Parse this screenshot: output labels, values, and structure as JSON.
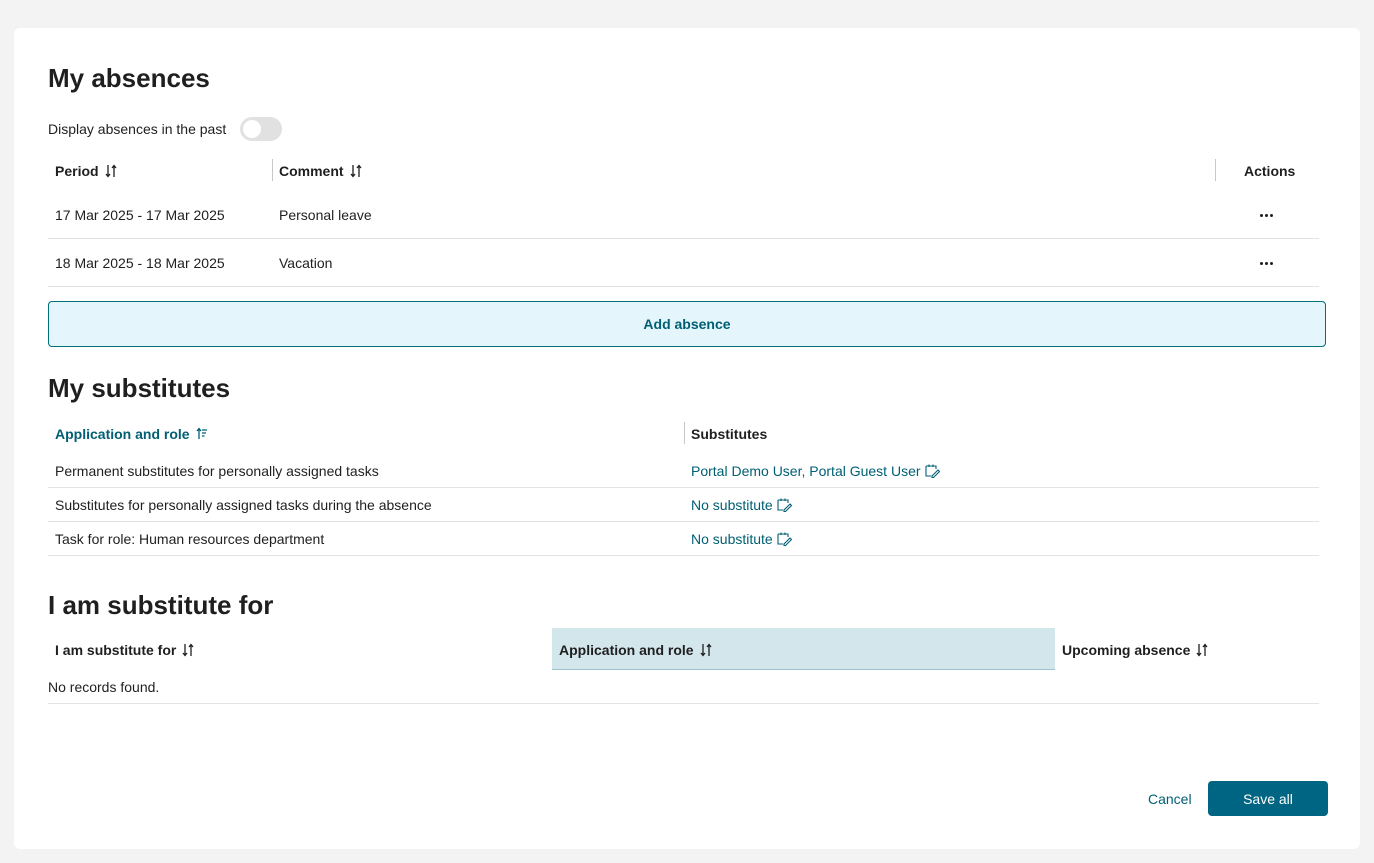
{
  "absences": {
    "title": "My absences",
    "toggle_label": "Display absences in the past",
    "toggle_on": false,
    "columns": {
      "period": "Period",
      "comment": "Comment",
      "actions": "Actions"
    },
    "rows": [
      {
        "period": "17 Mar 2025 - 17 Mar 2025",
        "comment": "Personal leave"
      },
      {
        "period": "18 Mar 2025 - 18 Mar 2025",
        "comment": "Vacation"
      }
    ],
    "add_label": "Add absence"
  },
  "substitutes": {
    "title": "My substitutes",
    "columns": {
      "app_role": "Application and role",
      "substitutes": "Substitutes"
    },
    "rows": [
      {
        "app_role": "Permanent substitutes for personally assigned tasks",
        "substitutes": "Portal Demo User, Portal Guest User"
      },
      {
        "app_role": "Substitutes for personally assigned tasks during the absence",
        "substitutes": "No substitute"
      },
      {
        "app_role": "Task for role: Human resources department",
        "substitutes": "No substitute"
      }
    ]
  },
  "substitute_for": {
    "title": "I am substitute for",
    "columns": {
      "person": "I am substitute for",
      "app_role": "Application and role",
      "upcoming": "Upcoming absence"
    },
    "empty_text": "No records found."
  },
  "footer": {
    "cancel_label": "Cancel",
    "save_label": "Save all"
  },
  "colors": {
    "accent": "#005f73",
    "primary_button": "#006582",
    "add_button_bg": "#e4f5fb",
    "highlight_header": "#d3e6ec"
  },
  "icons": {
    "sort": "sort-arrows-icon",
    "sort_active": "sort-ascending-icon",
    "more": "more-horizontal-icon",
    "edit": "edit-substitute-icon"
  }
}
